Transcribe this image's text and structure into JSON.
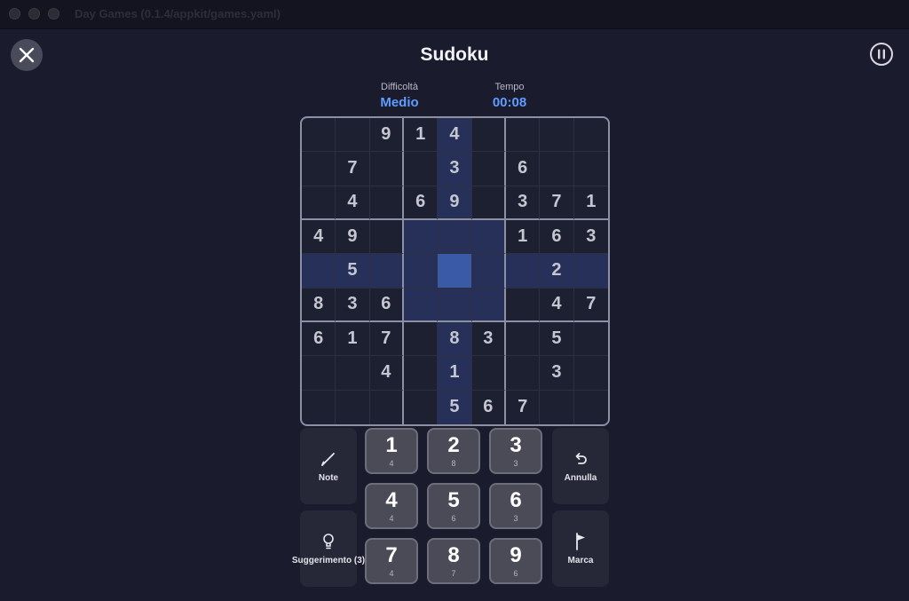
{
  "window": {
    "title": "Day Games (0.1.4/appkit/games.yaml)"
  },
  "header": {
    "title": "Sudoku"
  },
  "stats": {
    "difficulty_label": "Difficoltà",
    "difficulty_value": "Medio",
    "time_label": "Tempo",
    "time_value": "00:08"
  },
  "colors": {
    "accent": "#5f9cff",
    "selected_cell": "#3a5aa8",
    "highlight": "#263059"
  },
  "board": {
    "selected": [
      4,
      4
    ],
    "rows": [
      [
        "",
        "",
        "9",
        "1",
        "4",
        "",
        "",
        "",
        ""
      ],
      [
        "",
        "7",
        "",
        "",
        "3",
        "",
        "6",
        "",
        ""
      ],
      [
        "",
        "4",
        "",
        "6",
        "9",
        "",
        "3",
        "7",
        "1"
      ],
      [
        "4",
        "9",
        "",
        "",
        "",
        "",
        "1",
        "6",
        "3"
      ],
      [
        "",
        "5",
        "",
        "",
        "",
        "",
        "",
        "2",
        ""
      ],
      [
        "8",
        "3",
        "6",
        "",
        "",
        "",
        "",
        "4",
        "7"
      ],
      [
        "6",
        "1",
        "7",
        "",
        "8",
        "3",
        "",
        "5",
        ""
      ],
      [
        "",
        "",
        "4",
        "",
        "1",
        "",
        "",
        "3",
        ""
      ],
      [
        "",
        "",
        "",
        "",
        "5",
        "6",
        "7",
        "",
        ""
      ]
    ]
  },
  "controls": {
    "note_label": "Note",
    "undo_label": "Annulla",
    "hint_label": "Suggerimento (3)",
    "mark_label": "Marca"
  },
  "numpad": [
    {
      "num": "1",
      "count": "4"
    },
    {
      "num": "2",
      "count": "8"
    },
    {
      "num": "3",
      "count": "3"
    },
    {
      "num": "4",
      "count": "4"
    },
    {
      "num": "5",
      "count": "6"
    },
    {
      "num": "6",
      "count": "3"
    },
    {
      "num": "7",
      "count": "4"
    },
    {
      "num": "8",
      "count": "7"
    },
    {
      "num": "9",
      "count": "6"
    }
  ]
}
